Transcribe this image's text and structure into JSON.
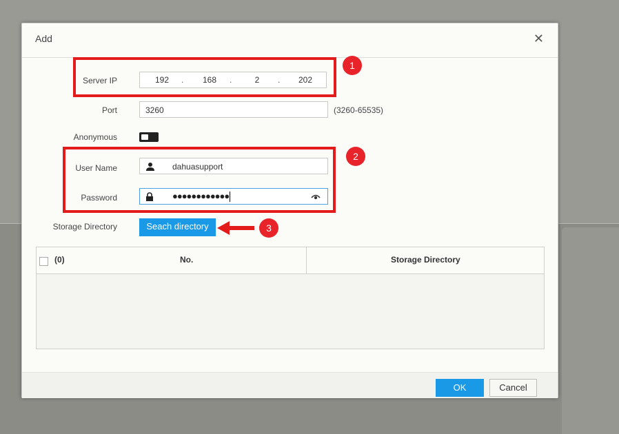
{
  "dialog": {
    "title": "Add",
    "close_icon": "close-icon"
  },
  "form": {
    "server_ip_label": "Server IP",
    "server_ip": [
      "192",
      "168",
      "2",
      "202"
    ],
    "ip_separator": ".",
    "port_label": "Port",
    "port_value": "3260",
    "port_range_hint": "(3260-65535)",
    "anonymous_label": "Anonymous",
    "anonymous_enabled": false,
    "username_label": "User Name",
    "username_value": "dahuasupport",
    "password_label": "Password",
    "password_value": "●●●●●●●●●●●●",
    "storage_dir_label": "Storage Directory",
    "search_button": "Seach directory"
  },
  "table": {
    "select_count": "(0)",
    "columns": [
      "No.",
      "Storage Directory"
    ],
    "rows": []
  },
  "footer": {
    "ok_label": "OK",
    "cancel_label": "Cancel"
  },
  "annotations": {
    "badge_1": "1",
    "badge_2": "2",
    "badge_3": "3",
    "color": "#e31b1b"
  },
  "colors": {
    "accent": "#1a9ae6"
  }
}
